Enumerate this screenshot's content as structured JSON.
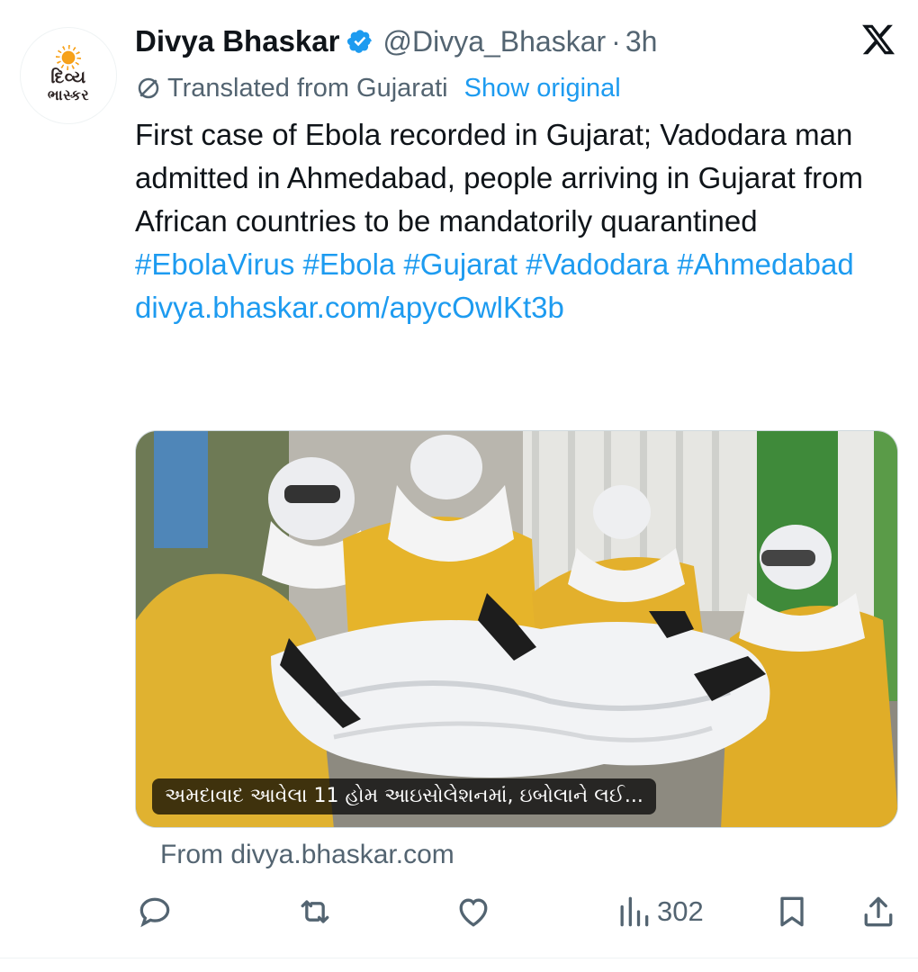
{
  "author": {
    "avatar_logo_line1": "દિવ્ય",
    "avatar_logo_line2": "ભાસ્કર",
    "name": "Divya Bhaskar",
    "handle": "@Divya_Bhaskar",
    "separator": "·",
    "time": "3h",
    "verified": true
  },
  "translation": {
    "label": "Translated from Gujarati",
    "show_original": "Show original"
  },
  "tweet": {
    "text": "First case of Ebola recorded in Gujarat; Vadodara man admitted in Ahmedabad, people arriving in Gujarat from African countries to be mandatorily quarantined",
    "hashtags": [
      "#EbolaVirus",
      "#Ebola",
      "#Gujarat",
      "#Vadodara",
      "#Ahmedabad"
    ],
    "link": "divya.bhaskar.com/apycOwlKt3b"
  },
  "card": {
    "caption": "અમદાવાદ આવેલા 11 હોમ આઇસોલેશનમાં, ઇબોલાને લઈ...",
    "source": "From divya.bhaskar.com"
  },
  "stats": {
    "views": "302"
  },
  "icons": {
    "verified": "verified-badge-icon",
    "x_logo": "x-logo-icon",
    "translate": "translate-icon",
    "reply": "reply-icon",
    "retweet": "retweet-icon",
    "like": "like-icon",
    "views": "views-icon",
    "bookmark": "bookmark-icon",
    "share": "share-icon"
  },
  "colors": {
    "accent": "#1d9bf0",
    "secondary_text": "#536471",
    "primary_text": "#0f1419"
  }
}
